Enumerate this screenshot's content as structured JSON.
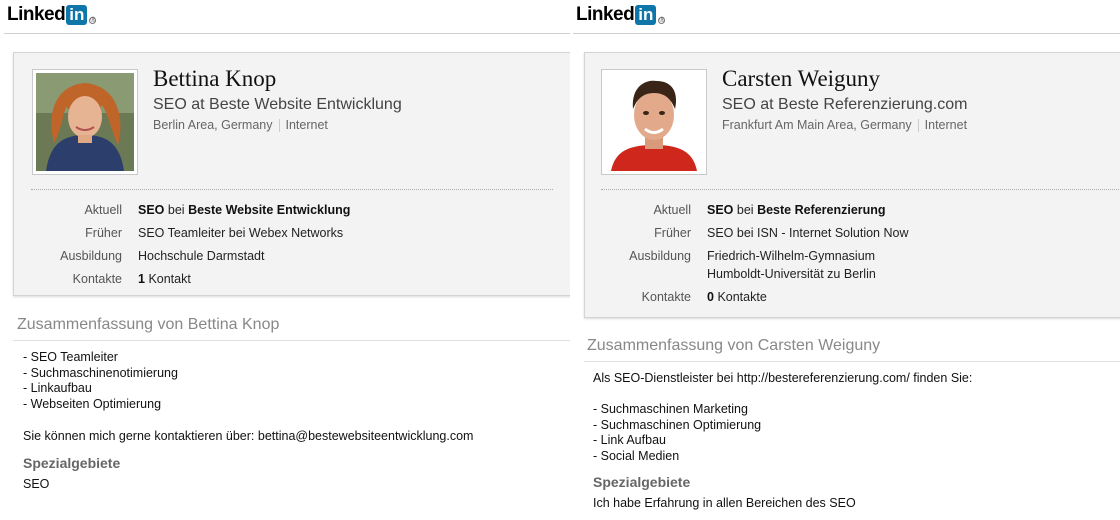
{
  "left": {
    "logo": {
      "text": "Linked",
      "box": "in"
    },
    "name": "Bettina Knop",
    "headline": "SEO at Beste Website Entwicklung",
    "location": "Berlin Area, Germany",
    "industry": "Internet",
    "rows": {
      "current_label": "Aktuell",
      "current_role": "SEO",
      "current_at": "bei",
      "current_company": "Beste Website Entwicklung",
      "past_label": "Früher",
      "past_value": "SEO Teamleiter bei Webex Networks",
      "edu_label": "Ausbildung",
      "edu_value": "Hochschule Darmstadt",
      "contacts_label": "Kontakte",
      "contacts_count": "1",
      "contacts_word": "Kontakt"
    },
    "summary_title": "Zusammenfassung von Bettina Knop",
    "summary_lines": [
      "- SEO Teamleiter",
      "- Suchmaschinenotimierung",
      "- Linkaufbau",
      "- Webseiten Optimierung"
    ],
    "summary_contact": "Sie können mich gerne kontaktieren über: bettina@bestewebsiteentwicklung.com",
    "specialties_title": "Spezialgebiete",
    "specialties_text": "SEO"
  },
  "right": {
    "logo": {
      "text": "Linked",
      "box": "in"
    },
    "name": "Carsten Weiguny",
    "headline": "SEO at Beste Referenzierung.com",
    "location": "Frankfurt Am Main Area, Germany",
    "industry": "Internet",
    "rows": {
      "current_label": "Aktuell",
      "current_role": "SEO",
      "current_at": "bei",
      "current_company": "Beste Referenzierung",
      "past_label": "Früher",
      "past_value": "SEO bei ISN - Internet Solution Now",
      "edu_label": "Ausbildung",
      "edu_value_1": "Friedrich-Wilhelm-Gymnasium",
      "edu_value_2": "Humboldt-Universität zu Berlin",
      "contacts_label": "Kontakte",
      "contacts_count": "0",
      "contacts_word": "Kontakte"
    },
    "summary_title": "Zusammenfassung von Carsten Weiguny",
    "summary_intro": "Als SEO-Dienstleister bei http://bestereferenzierung.com/ finden Sie:",
    "summary_lines": [
      "- Suchmaschinen Marketing",
      "- Suchmaschinen Optimierung",
      "- Link Aufbau",
      "- Social Medien"
    ],
    "specialties_title": "Spezialgebiete",
    "specialties_text": "Ich habe Erfahrung in allen Bereichen des SEO"
  }
}
